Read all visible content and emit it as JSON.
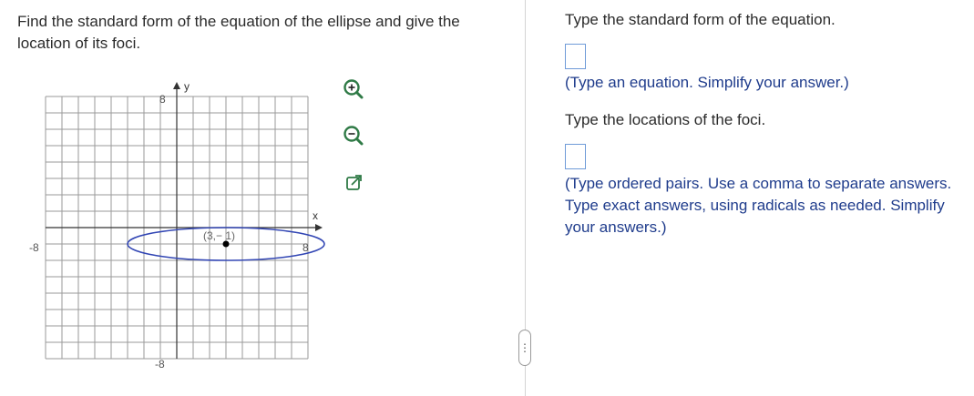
{
  "question": {
    "text": "Find the standard form of the equation of the ellipse and give the location of its foci."
  },
  "graph": {
    "y_axis_label": "y",
    "x_axis_label": "x",
    "y_max_label": "8",
    "y_min_label": "-8",
    "x_max_label": "8",
    "x_min_label": "-8",
    "center_label": "(3,− 1)",
    "ellipse_color": "#3246b4",
    "point_color": "#000000",
    "x_range": [
      -8,
      8
    ],
    "y_range": [
      -8,
      8
    ],
    "ellipse_center": [
      3,
      -1
    ],
    "ellipse_semi_axis_x": 6,
    "ellipse_semi_axis_y": 1
  },
  "tools": {
    "zoom_in": "zoom-in-icon",
    "zoom_out": "zoom-out-icon",
    "popout": "popout-icon"
  },
  "divider_handle": "⋮",
  "answers": {
    "equation_prompt": "Type the standard form of the equation.",
    "equation_hint": "(Type an equation. Simplify your answer.)",
    "foci_prompt": "Type the locations of the foci.",
    "foci_hint": "(Type ordered pairs. Use a comma to separate answers. Type exact answers, using radicals as needed. Simplify your answers.)"
  }
}
